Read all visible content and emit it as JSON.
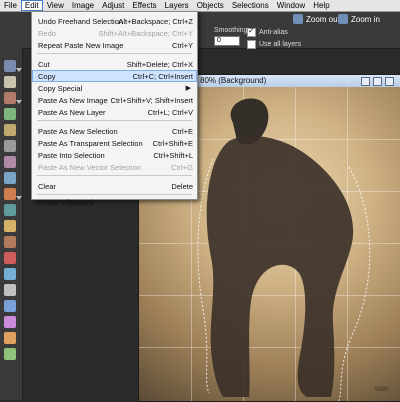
{
  "menubar": {
    "items": [
      "File",
      "Edit",
      "View",
      "Image",
      "Adjust",
      "Effects",
      "Layers",
      "Objects",
      "Selections",
      "Window",
      "Help"
    ]
  },
  "toolbar": {
    "zoom_out_label": "Zoom out",
    "zoom_in_label": "Zoom in",
    "smoothing_label": "Smoothing:",
    "smoothing_value": "0",
    "anti_alias_label": "Anti-alias",
    "use_all_layers_label": "Use all layers"
  },
  "edit_menu": {
    "items": [
      {
        "label": "Undo Freehand Selection",
        "shortcut": "Alt+Backspace; Ctrl+Z",
        "disabled": false
      },
      {
        "label": "Redo",
        "shortcut": "Shift+Alt+Backspace; Ctrl+Y",
        "disabled": true
      },
      {
        "label": "Repeat Paste New Image",
        "shortcut": "Ctrl+Y",
        "disabled": false
      },
      {
        "label": "Cut",
        "shortcut": "Shift+Delete; Ctrl+X",
        "disabled": false
      },
      {
        "label": "Copy",
        "shortcut": "Ctrl+C; Ctrl+Insert",
        "disabled": false
      },
      {
        "label": "Copy Special",
        "shortcut": "",
        "disabled": false
      },
      {
        "label": "Paste As New Image",
        "shortcut": "Ctrl+Shift+V; Shift+Insert",
        "disabled": false
      },
      {
        "label": "Paste As New Layer",
        "shortcut": "Ctrl+L; Ctrl+V",
        "disabled": false
      },
      {
        "label": "Paste As New Selection",
        "shortcut": "Ctrl+E",
        "disabled": false
      },
      {
        "label": "Paste As Transparent Selection",
        "shortcut": "Ctrl+Shift+E",
        "disabled": false
      },
      {
        "label": "Paste Into Selection",
        "shortcut": "Ctrl+Shift+L",
        "disabled": false
      },
      {
        "label": "Paste As New Vector Selection",
        "shortcut": "Ctrl+G",
        "disabled": true
      },
      {
        "label": "Clear",
        "shortcut": "Delete",
        "disabled": false
      },
      {
        "label": "Empty Clipboard",
        "shortcut": "",
        "disabled": false
      }
    ],
    "selected_item": "Copy"
  },
  "document": {
    "title": "80% (Background)",
    "stamp": "5980"
  },
  "colors": {
    "menu_highlight": "#cfe3ff",
    "menubar_bg": "#e6e6e6",
    "panel_bg": "#3a3a3a"
  }
}
